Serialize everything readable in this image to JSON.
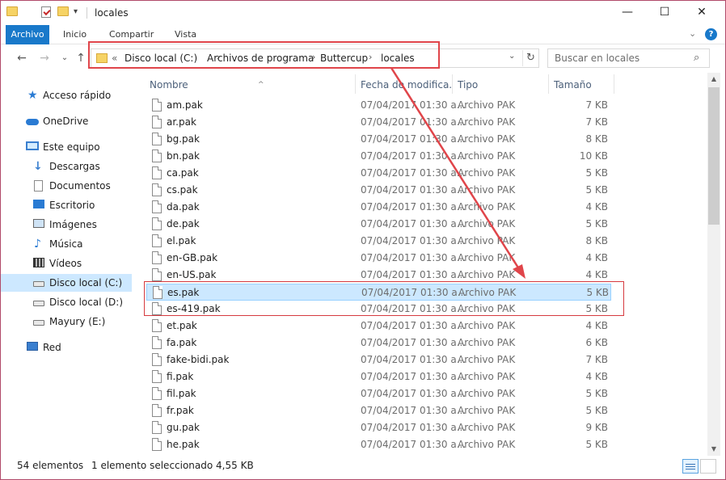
{
  "window": {
    "title": "locales",
    "minimize": "—",
    "maximize": "☐",
    "close": "✕"
  },
  "ribbon": {
    "tabs": [
      "Archivo",
      "Inicio",
      "Compartir",
      "Vista"
    ],
    "expand_chevron": "⌄",
    "help": "?"
  },
  "address": {
    "prefix": "«",
    "segments": [
      "Disco local (C:)",
      "Archivos de programa",
      "Buttercup",
      "locales"
    ],
    "separator": "›",
    "dropdown": "⌄",
    "refresh": "↻"
  },
  "search": {
    "placeholder": "Buscar en locales",
    "icon": "⌕"
  },
  "nav_buttons": {
    "back": "←",
    "forward": "→",
    "recent": "⌄",
    "up": "↑"
  },
  "sidebar": {
    "items": [
      {
        "label": "Acceso rápido",
        "icon": "star-icon"
      },
      {
        "label": "OneDrive",
        "icon": "cloud-icon"
      },
      {
        "label": "Este equipo",
        "icon": "computer-icon"
      },
      {
        "label": "Descargas",
        "icon": "download-icon"
      },
      {
        "label": "Documentos",
        "icon": "document-icon"
      },
      {
        "label": "Escritorio",
        "icon": "desktop-icon"
      },
      {
        "label": "Imágenes",
        "icon": "pictures-icon"
      },
      {
        "label": "Música",
        "icon": "music-icon"
      },
      {
        "label": "Vídeos",
        "icon": "video-icon"
      },
      {
        "label": "Disco local (C:)",
        "icon": "drive-icon",
        "selected": true
      },
      {
        "label": "Disco local (D:)",
        "icon": "drive-icon"
      },
      {
        "label": "Mayury  (E:)",
        "icon": "drive-icon"
      },
      {
        "label": "Red",
        "icon": "network-icon"
      }
    ]
  },
  "columns": {
    "name": "Nombre",
    "date": "Fecha de modifica...",
    "type": "Tipo",
    "size": "Tamaño"
  },
  "files": [
    {
      "name": "am.pak",
      "date": "07/04/2017 01:30 a...",
      "type": "Archivo PAK",
      "size": "7 KB"
    },
    {
      "name": "ar.pak",
      "date": "07/04/2017 01:30 a...",
      "type": "Archivo PAK",
      "size": "7 KB"
    },
    {
      "name": "bg.pak",
      "date": "07/04/2017 01:30 a...",
      "type": "Archivo PAK",
      "size": "8 KB"
    },
    {
      "name": "bn.pak",
      "date": "07/04/2017 01:30 a...",
      "type": "Archivo PAK",
      "size": "10 KB"
    },
    {
      "name": "ca.pak",
      "date": "07/04/2017 01:30 a...",
      "type": "Archivo PAK",
      "size": "5 KB"
    },
    {
      "name": "cs.pak",
      "date": "07/04/2017 01:30 a...",
      "type": "Archivo PAK",
      "size": "5 KB"
    },
    {
      "name": "da.pak",
      "date": "07/04/2017 01:30 a...",
      "type": "Archivo PAK",
      "size": "4 KB"
    },
    {
      "name": "de.pak",
      "date": "07/04/2017 01:30 a...",
      "type": "Archivo PAK",
      "size": "5 KB"
    },
    {
      "name": "el.pak",
      "date": "07/04/2017 01:30 a...",
      "type": "Archivo PAK",
      "size": "8 KB"
    },
    {
      "name": "en-GB.pak",
      "date": "07/04/2017 01:30 a...",
      "type": "Archivo PAK",
      "size": "4 KB"
    },
    {
      "name": "en-US.pak",
      "date": "07/04/2017 01:30 a...",
      "type": "Archivo PAK",
      "size": "4 KB"
    },
    {
      "name": "es.pak",
      "date": "07/04/2017 01:30 a...",
      "type": "Archivo PAK",
      "size": "5 KB",
      "selected": true
    },
    {
      "name": "es-419.pak",
      "date": "07/04/2017 01:30 a...",
      "type": "Archivo PAK",
      "size": "5 KB"
    },
    {
      "name": "et.pak",
      "date": "07/04/2017 01:30 a...",
      "type": "Archivo PAK",
      "size": "4 KB"
    },
    {
      "name": "fa.pak",
      "date": "07/04/2017 01:30 a...",
      "type": "Archivo PAK",
      "size": "6 KB"
    },
    {
      "name": "fake-bidi.pak",
      "date": "07/04/2017 01:30 a...",
      "type": "Archivo PAK",
      "size": "7 KB"
    },
    {
      "name": "fi.pak",
      "date": "07/04/2017 01:30 a...",
      "type": "Archivo PAK",
      "size": "4 KB"
    },
    {
      "name": "fil.pak",
      "date": "07/04/2017 01:30 a...",
      "type": "Archivo PAK",
      "size": "5 KB"
    },
    {
      "name": "fr.pak",
      "date": "07/04/2017 01:30 a...",
      "type": "Archivo PAK",
      "size": "5 KB"
    },
    {
      "name": "gu.pak",
      "date": "07/04/2017 01:30 a...",
      "type": "Archivo PAK",
      "size": "9 KB"
    },
    {
      "name": "he.pak",
      "date": "07/04/2017 01:30 a...",
      "type": "Archivo PAK",
      "size": "5 KB"
    }
  ],
  "status": {
    "count": "54 elementos",
    "selection": "1 elemento seleccionado  4,55 KB"
  },
  "colors": {
    "accent": "#1979ca",
    "selection_bg": "#cce8ff",
    "annotation_red": "#e0454a"
  }
}
